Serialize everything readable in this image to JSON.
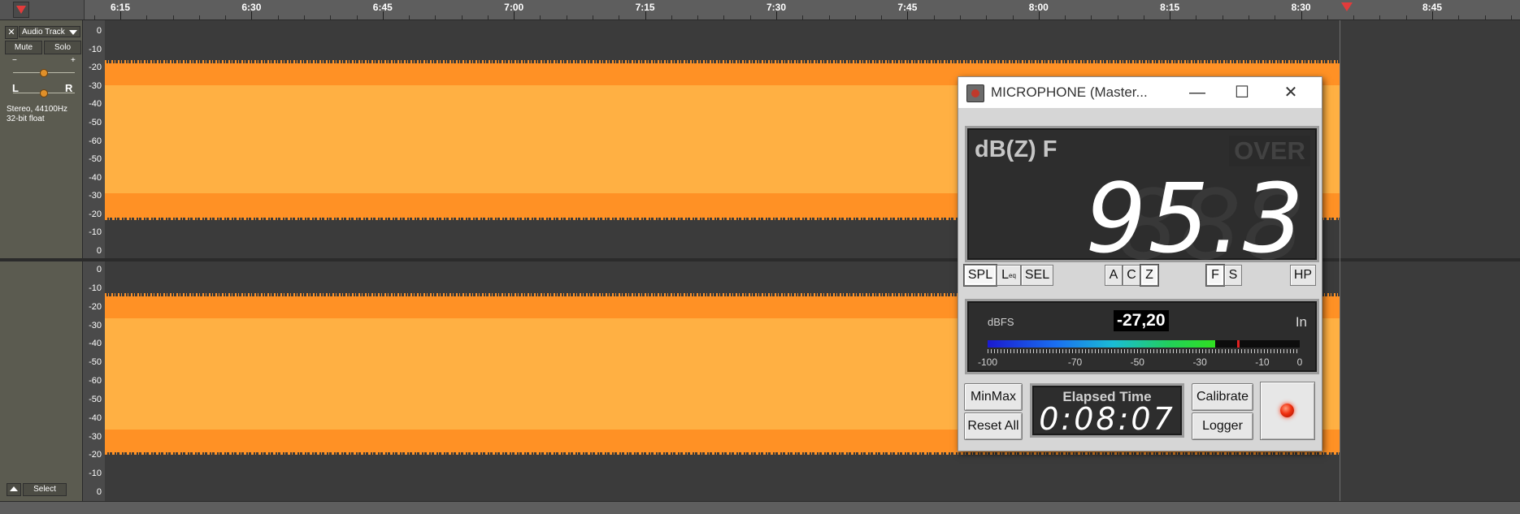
{
  "ruler": {
    "labels": [
      "6:15",
      "6:30",
      "6:45",
      "7:00",
      "7:15",
      "7:30",
      "7:45",
      "8:00",
      "8:15",
      "8:30",
      "8:45"
    ]
  },
  "track": {
    "name": "Audio Track",
    "close": "✕",
    "mute": "Mute",
    "solo": "Solo",
    "gain_minus": "−",
    "gain_plus": "+",
    "pan_left": "L",
    "pan_right": "R",
    "info_line1": "Stereo, 44100Hz",
    "info_line2": "32-bit float",
    "select": "Select"
  },
  "scale": {
    "labels": [
      "0",
      "-10",
      "-20",
      "-30",
      "-40",
      "-50",
      "-60",
      "-50",
      "-40",
      "-30",
      "-20",
      "-10",
      "0"
    ]
  },
  "colors": {
    "waveform_outer": "#ff9125",
    "waveform_inner": "#ffb043",
    "accent_red": "#e23b3b"
  },
  "meter": {
    "title": "MICROPHONE (Master...",
    "minimize": "—",
    "maximize": "☐",
    "close": "✕",
    "mode": "dB(Z) F",
    "over": "OVER",
    "ghost": "888",
    "value": "95.3",
    "buttons": {
      "spl": "SPL",
      "leq_main": "L",
      "leq_sub": "eq",
      "sel": "SEL",
      "a": "A",
      "c": "C",
      "z": "Z",
      "f": "F",
      "s": "S",
      "hp": "HP"
    },
    "dbfs": {
      "label": "dBFS",
      "value": "-27,20",
      "in": "In",
      "level": 0.728,
      "peak": 0.8,
      "ticks": [
        "-100",
        "-70",
        "-50",
        "-30",
        "-10",
        "0"
      ]
    },
    "minmax": "MinMax",
    "reset_all": "Reset All",
    "elapsed_label": "Elapsed Time",
    "elapsed_value": "0:08:07",
    "calibrate": "Calibrate",
    "logger": "Logger"
  }
}
